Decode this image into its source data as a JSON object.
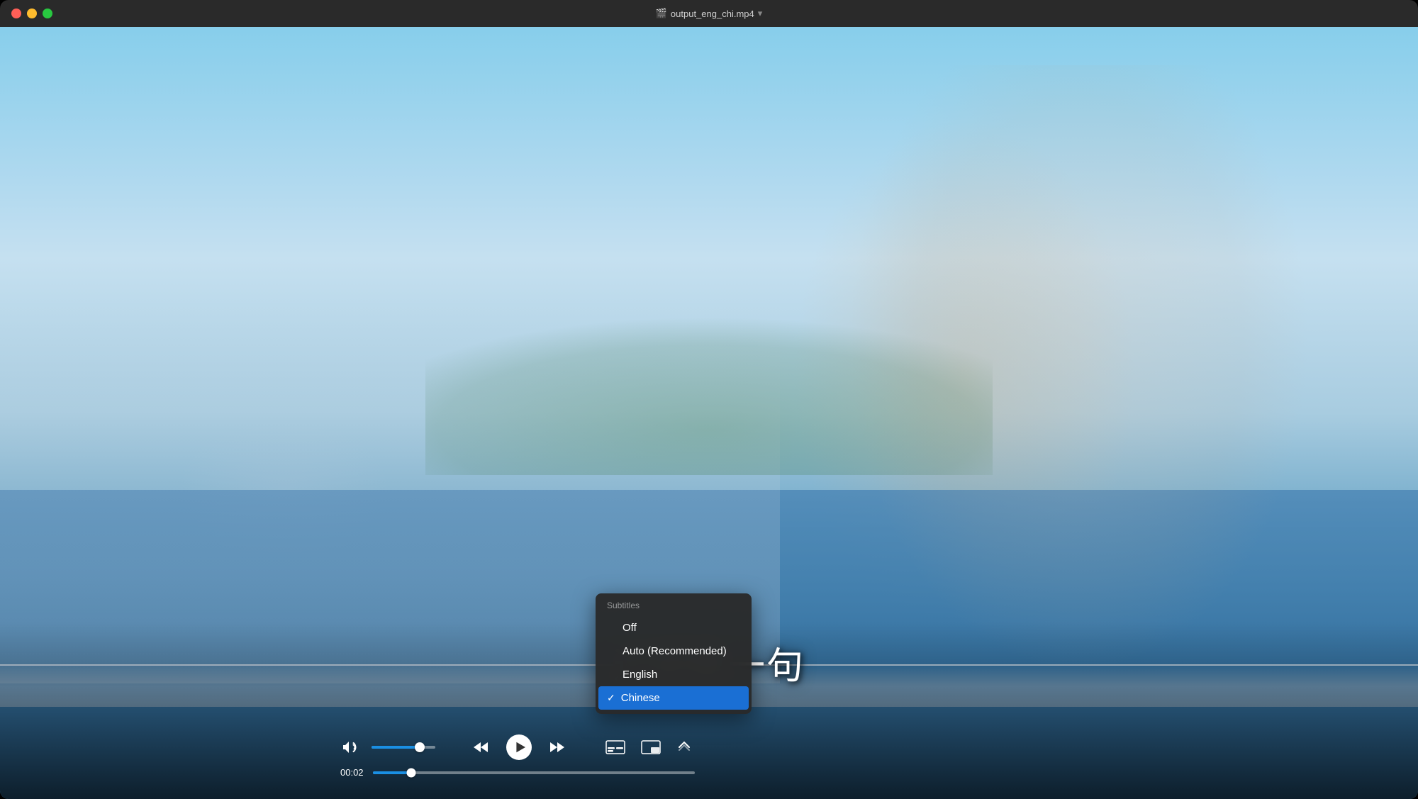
{
  "window": {
    "title": "output_eng_chi.mp4",
    "title_arrow": "›",
    "traffic_lights": {
      "close": "close",
      "minimize": "minimize",
      "maximize": "maximize"
    }
  },
  "video": {
    "subtitle_text": "这是第一句",
    "current_time": "00:02",
    "volume_percent": 75,
    "progress_percent": 12
  },
  "controls": {
    "volume_icon": "🔊",
    "rewind_label": "rewind",
    "play_label": "play",
    "forward_label": "fast-forward",
    "subtitle_btn_label": "subtitles",
    "pip_btn_label": "picture-in-picture",
    "more_btn_label": "more"
  },
  "subtitles_menu": {
    "header": "Subtitles",
    "items": [
      {
        "id": "off",
        "label": "Off",
        "active": false
      },
      {
        "id": "auto",
        "label": "Auto (Recommended)",
        "active": false
      },
      {
        "id": "english",
        "label": "English",
        "active": false
      },
      {
        "id": "chinese",
        "label": "Chinese",
        "active": true
      }
    ]
  }
}
